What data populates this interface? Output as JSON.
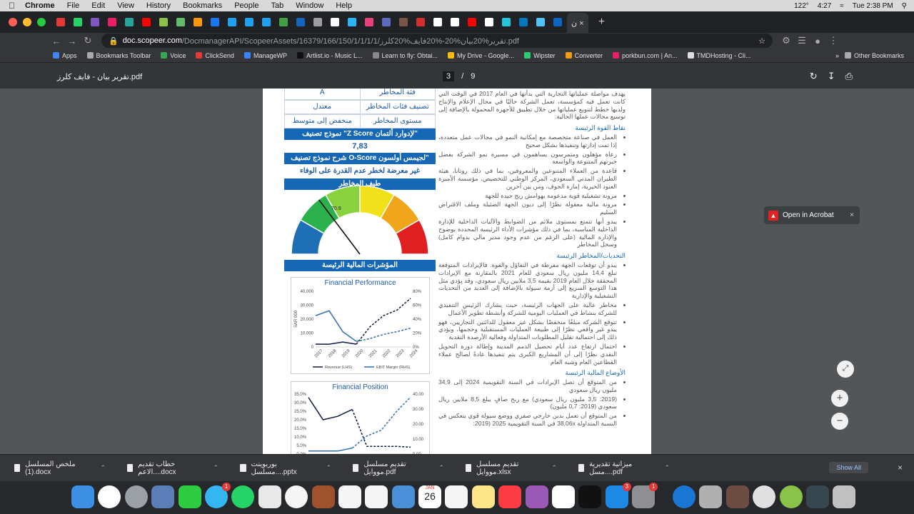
{
  "menubar": {
    "app": "Chrome",
    "items": [
      "File",
      "Edit",
      "View",
      "History",
      "Bookmarks",
      "People",
      "Tab",
      "Window",
      "Help"
    ],
    "temp": "122°",
    "time_left": "4:27",
    "clock": "Tue 2:38 PM"
  },
  "tabs": {
    "active_label": "ن ×"
  },
  "omnibox": {
    "host": "doc.scopeer.com",
    "path": "/DocmanagerAPI/ScopeerAssets/16379/166/150/1/1/1/1/تقرير%20بيان%20-%20فايف%20كلرز.pdf"
  },
  "bookmarks": [
    {
      "label": "Apps",
      "color": "#4285f4"
    },
    {
      "label": "Bookmarks Toolbar",
      "color": "#aaaaaa"
    },
    {
      "label": "Voice",
      "color": "#34a853"
    },
    {
      "label": "ClickSend",
      "color": "#e53935"
    },
    {
      "label": "ManageWP",
      "color": "#3b82f6"
    },
    {
      "label": "Artlist.io - Music L...",
      "color": "#111111"
    },
    {
      "label": "Learn to fly: Obtai...",
      "color": "#888888"
    },
    {
      "label": "My Drive - Google...",
      "color": "#fbbc05"
    },
    {
      "label": "Wipster",
      "color": "#2ecc71"
    },
    {
      "label": "Converter",
      "color": "#f39c12"
    },
    {
      "label": "porkbun.com | An...",
      "color": "#e91e63"
    },
    {
      "label": "TMDHosting - Cli...",
      "color": "#dddddd"
    }
  ],
  "bookmarks_other": "Other Bookmarks",
  "pdf": {
    "title": "تقرير بيان - فايف كلرز.pdf",
    "page_current": "3",
    "page_sep": "/",
    "page_total": "9"
  },
  "left_col": {
    "rows": [
      {
        "label": "فئة المخاطر",
        "value": "A"
      },
      {
        "label": "تصنيف فئات المخاطر",
        "value": "معتدل"
      },
      {
        "label": "مستوى المخاطر",
        "value": "منخفض إلى متوسط"
      }
    ],
    "zscore_title": "نموذج تصنيف \"Z Score لإدوارد ألتمان\"",
    "zscore_value": "7,83",
    "oscore_title": "شرح نموذج تصنيف O-Score لجيمس أولسون\"",
    "oscore_text": "غير معرضة لخطر عدم القدرة على الوفاء بالالتزامات",
    "spectrum_title": "طيف المخاطر",
    "gauge_value": "70.9",
    "indicators_title": "المؤشرات المالية الرئيسة",
    "fp_title": "Financial Performance",
    "fpos_title": "Financial Position"
  },
  "right_col": {
    "intro": "يهدف مواصلة عملياتها التجارية التي بدأتها في العام 2017 في الوقت التي كانت تعمل فيه كمؤسسة، تعمل الشركة حاليًا في مجال الإعلام والإنتاج ولديها خطط لتنويع عملياتها من خلال تطبيق للأجهزة المحمولة بالإضافة إلى توسيع مجالات عملها الحالية.",
    "strengths_title": "نقاط القوة الرئيسة",
    "strengths": [
      "العمل في صناعة متخصصة مع إمكانية النمو في مجالات عمل متعددة، إذا تمت إدارتها وتنفيذها بشكل صحيح",
      "رعاة مؤهلون ومتمرسون يساهمون في مسيرة نمو الشركة بفضل خبرتهم المتنوعة والواسعة",
      "قاعدة من العملاء المتنوعين والمعروفين، بما في ذلك روتانا، هيئة الطيران المدني السعودي، المركز الوطني للتخصيص، مؤسسة الأميرة العنود الخيرية، إمارة الجوف، ومن بين آخرين",
      "مرونة تشغيلية قوية مدعومة بهوامش ربح جيدة للجهة",
      "مرونة مالية معقولة نظرًا إلى ديون الجهة الضئيلة وملف الاقتراض السليم",
      "يبدو أنها تتمتع بمستوى ملائم من الضوابط والآليات الداخلية للإدارة الداخلية المناسبة، بما في ذلك مؤشرات الأداء الرئيسة المحددة بوضوح والإدارة المالية (على الرغم من عدم وجود مدير مالي بدوام كامل) وسجل المخاطر"
    ],
    "challenges_title": "التحديات/المخاطر الرئيسة",
    "challenges": [
      "يبدو أن توقعات الجهة مفرطة في التفاؤل والقوة. فالإيرادات المتوقعة تبلغ 14,4 مليون ريال سعودي للعام 2021 بالمقارنة مع الإيرادات المحققة خلال العام 2019 بقيمة 3,5 ملايين ريال سعودي، وقد يؤدي مثل هذا التوسع السريع إلى أزمة سيولة بالإضافة إلى العديد من التحديات التشغيلية والإدارية",
      "مخاطر عالية على الجهات الرئيسة، حيث يشارك الرئيس التنفيذي للشركة بنشاط في العمليات اليومية للشركة وأنشطة تطوير الأعمال",
      "تتوقع الشركة مبلغًا منخفضًا بشكل غير معقول للدائنين التجاريين، فهو يبدو غير واقعي نظرًا إلى طبيعة العمليات المستقبلية وحجمها، ويؤدي ذلك إلى احتمالية تقليل المطلوبات المتداولة وفعالية الأرصدة النقدية",
      "احتمال ارتفاع عدد أيام تحصيل الذمم المدينة وإطالة دورة التحويل النقدي نظرًا إلى أن المشاريع الكبرى يتم تنفيذها عادةً لصالح عملاء القطاعين العام وشبه العام"
    ],
    "fin_title": "الأوضاع المالية الرئيسة",
    "fin": [
      "من المتوقع أن تصل الإيرادات في السنة التقويمية 2024 إلى 34,9 مليون ريال سعودي",
      "(2019: 3,5 مليون ريال سعودي) مع ربح صافٍ يبلغ 8,5 ملايين ريال سعودي (2019: 0,7 مليون)",
      "من المتوقع أن تعمل بدين خارجي صفري ووضع سيولة قوي ينعكس في النسبة المتداولة 38,06x في السنة التقويمية 2025 (2019:"
    ]
  },
  "chart_data": [
    {
      "type": "line",
      "title": "Financial Performance",
      "ylabel": "SAR 000",
      "x": [
        "2017",
        "2018",
        "2019",
        "2020",
        "2021",
        "2022",
        "2023",
        "2024"
      ],
      "ylim": [
        0,
        40000
      ],
      "y2lim": [
        0,
        80
      ],
      "series": [
        {
          "name": "Revenue (LHS)",
          "axis": "left",
          "color": "#0d1b3e",
          "values": [
            2000,
            2000,
            3500,
            2000,
            14400,
            22500,
            26500,
            34900
          ]
        },
        {
          "name": "EBIT Margin (RHS)",
          "axis": "right",
          "color": "#2f6db5",
          "values": [
            45,
            52,
            22,
            8,
            12,
            18,
            22,
            27
          ]
        }
      ],
      "legend": "bottom"
    },
    {
      "type": "line",
      "title": "Financial Position",
      "ylim": [
        0,
        0.35
      ],
      "y2lim": [
        0,
        40
      ],
      "yticks": [
        "0.0%",
        "5.0%",
        "10.0%",
        "15.0%",
        "20.0%",
        "25.0%",
        "30.0%",
        "35.0%"
      ],
      "y2ticks": [
        "0.00",
        "10.00",
        "20.00",
        "30.00",
        "40.00"
      ],
      "series": [
        {
          "name": "",
          "axis": "left",
          "color": "#0d1b3e",
          "values": [
            0.33,
            0.2,
            0.22,
            0.26,
            0.045,
            0.045,
            0.045,
            0.04
          ]
        },
        {
          "name": "",
          "axis": "right",
          "color": "#2f6db5",
          "values": [
            2,
            2,
            2,
            4,
            12,
            16,
            28,
            38
          ]
        }
      ]
    }
  ],
  "acrobat": {
    "label": "Open in Acrobat"
  },
  "downloads": [
    "ملخص المسلسل (1).docx",
    "خطاب تقديم الاعم....docx",
    "بوربوينت مسلسل....pptx",
    "تقديم مسلسل مووايل.pdf",
    "تقديم مسلسل مووايل.xlsx",
    "ميزانية تقديرية مسل....pdf"
  ],
  "show_all": "Show All",
  "dock": {
    "calendar_month": "JAN",
    "calendar_day": "26",
    "badges": {
      "messages": "1",
      "appstore": "3",
      "prefs": "1"
    }
  }
}
